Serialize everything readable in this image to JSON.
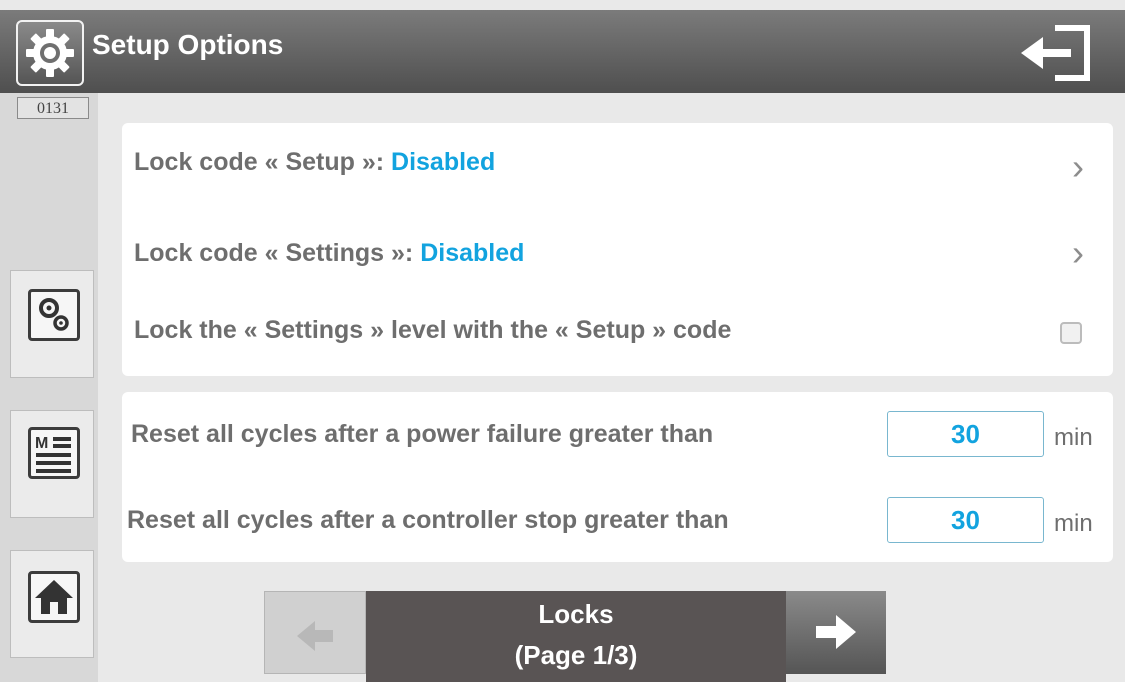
{
  "header": {
    "title": "Setup Options",
    "settings_icon": "gear-icon",
    "exit_icon": "exit-icon"
  },
  "sidebar": {
    "code": "0131",
    "items": [
      {
        "icon": "gears-icon"
      },
      {
        "icon": "menu-list-icon"
      },
      {
        "icon": "home-icon"
      }
    ]
  },
  "locks": {
    "setup": {
      "label": "Lock code « Setup »:",
      "value": "Disabled"
    },
    "settings": {
      "label": "Lock code « Settings »:",
      "value": "Disabled"
    },
    "combine": {
      "label": "Lock the « Settings » level with the « Setup » code",
      "checked": false
    }
  },
  "reset": {
    "power_failure": {
      "label": "Reset all cycles after a power failure greater than",
      "value": "30",
      "unit": "min"
    },
    "controller_stop": {
      "label": "Reset all cycles after a controller stop greater than",
      "value": "30",
      "unit": "min"
    }
  },
  "pager": {
    "title": "Locks",
    "page": "(Page 1/3)",
    "prev_icon": "arrow-left-icon",
    "next_icon": "arrow-right-icon"
  },
  "colors": {
    "accent": "#12a3df",
    "header": "#5f5f5f",
    "label": "#6e6e6e"
  }
}
